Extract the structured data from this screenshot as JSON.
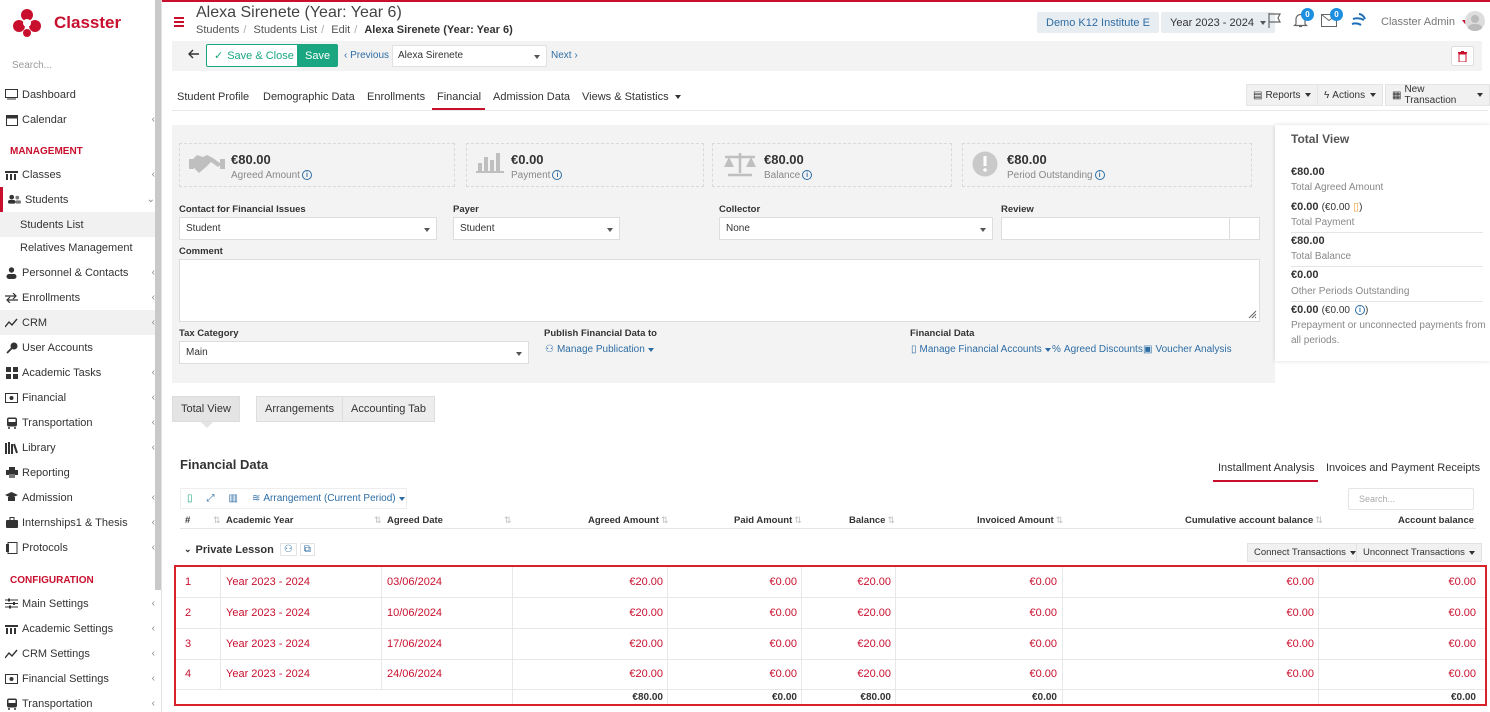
{
  "app": {
    "brand": "Classter",
    "search_placeholder": "Search..."
  },
  "sidebar": {
    "items": [
      {
        "label": "Dashboard",
        "icon": "monitor-icon"
      },
      {
        "label": "Calendar",
        "icon": "calendar-icon"
      },
      {
        "label": "Classes",
        "icon": "classes-icon"
      },
      {
        "label": "Students",
        "icon": "students-icon"
      },
      {
        "label": "Students List"
      },
      {
        "label": "Relatives Management"
      },
      {
        "label": "Personnel & Contacts",
        "icon": "person-icon"
      },
      {
        "label": "Enrollments",
        "icon": "arrows-icon"
      },
      {
        "label": "CRM",
        "icon": "crm-icon"
      },
      {
        "label": "User Accounts",
        "icon": "key-icon"
      },
      {
        "label": "Academic Tasks",
        "icon": "grid-icon"
      },
      {
        "label": "Financial",
        "icon": "money-icon"
      },
      {
        "label": "Transportation",
        "icon": "bus-icon"
      },
      {
        "label": "Library",
        "icon": "books-icon"
      },
      {
        "label": "Reporting",
        "icon": "printer-icon"
      },
      {
        "label": "Admission",
        "icon": "admission-icon"
      },
      {
        "label": "Internships1 & Thesis",
        "icon": "briefcase-icon"
      },
      {
        "label": "Protocols",
        "icon": "protocol-icon"
      },
      {
        "label": "Main Settings",
        "icon": "sliders-icon"
      },
      {
        "label": "Academic Settings",
        "icon": "classes-icon"
      },
      {
        "label": "CRM Settings",
        "icon": "crm-icon"
      },
      {
        "label": "Financial Settings",
        "icon": "money-icon"
      },
      {
        "label": "Transportation",
        "icon": "bus-icon"
      }
    ],
    "section_management": "MANAGEMENT",
    "section_configuration": "CONFIGURATION"
  },
  "header": {
    "title": "Alexa Sirenete (Year: Year 6)",
    "breadcrumb": [
      "Students",
      "Students List",
      "Edit",
      "Alexa Sirenete (Year: Year 6)"
    ],
    "institute": "Demo K12 Institute E",
    "year": "Year 2023 - 2024",
    "notifications_count": "0",
    "messages_count": "0",
    "user": "Classter Admin"
  },
  "toolbar": {
    "save_close": "Save & Close",
    "save": "Save",
    "previous": "Previous",
    "next": "Next",
    "student": "Alexa Sirenete"
  },
  "tabs": [
    "Student Profile",
    "Demographic Data",
    "Enrollments",
    "Financial",
    "Admission Data",
    "Views & Statistics"
  ],
  "actions": {
    "reports": "Reports",
    "actions": "Actions",
    "new_transaction": "New Transaction"
  },
  "kpis": [
    {
      "value": "€80.00",
      "label": "Agreed Amount"
    },
    {
      "value": "€0.00",
      "label": "Payment"
    },
    {
      "value": "€80.00",
      "label": "Balance"
    },
    {
      "value": "€80.00",
      "label": "Period Outstanding"
    }
  ],
  "form": {
    "contact_label": "Contact for Financial Issues",
    "contact_value": "Student",
    "payer_label": "Payer",
    "payer_value": "Student",
    "collector_label": "Collector",
    "collector_value": "None",
    "review_label": "Review",
    "comment_label": "Comment",
    "tax_label": "Tax Category",
    "tax_value": "Main",
    "publish_label": "Publish Financial Data to",
    "manage_publication": "Manage Publication",
    "fin_data_label": "Financial Data",
    "manage_accounts": "Manage Financial Accounts",
    "agreed_discounts": "Agreed Discounts",
    "voucher_analysis": "Voucher Analysis"
  },
  "total_view": {
    "title": "Total View",
    "rows": [
      {
        "value": "€80.00",
        "sub": "",
        "label": "Total Agreed Amount"
      },
      {
        "value": "€0.00",
        "sub": "(€0.00",
        "label": "Total Payment"
      },
      {
        "value": "€80.00",
        "sub": "",
        "label": "Total Balance"
      },
      {
        "value": "€0.00",
        "sub": "",
        "label": "Other Periods Outstanding"
      },
      {
        "value": "€0.00",
        "sub": "(€0.00",
        "label": "Prepayment or unconnected payments from all periods."
      }
    ],
    "close_paren": ")"
  },
  "subtabs": [
    "Total View",
    "Arrangements",
    "Accounting Tab"
  ],
  "financial": {
    "title": "Financial Data",
    "tab_installment": "Installment Analysis",
    "tab_invoices": "Invoices and Payment Receipts",
    "search_placeholder": "Search...",
    "arrangement": "Arrangement (Current Period)",
    "columns": [
      "#",
      "Academic Year",
      "Agreed Date",
      "Agreed Amount",
      "Paid Amount",
      "Balance",
      "Invoiced Amount",
      "Cumulative account balance",
      "Account balance"
    ],
    "group": "Private Lesson",
    "connect": "Connect Transactions",
    "unconnect": "Unconnect Transactions",
    "rows": [
      [
        "1",
        "Year 2023 - 2024",
        "03/06/2024",
        "€20.00",
        "€0.00",
        "€20.00",
        "€0.00",
        "€0.00",
        "€0.00"
      ],
      [
        "2",
        "Year 2023 - 2024",
        "10/06/2024",
        "€20.00",
        "€0.00",
        "€20.00",
        "€0.00",
        "€0.00",
        "€0.00"
      ],
      [
        "3",
        "Year 2023 - 2024",
        "17/06/2024",
        "€20.00",
        "€0.00",
        "€20.00",
        "€0.00",
        "€0.00",
        "€0.00"
      ],
      [
        "4",
        "Year 2023 - 2024",
        "24/06/2024",
        "€20.00",
        "€0.00",
        "€20.00",
        "€0.00",
        "€0.00",
        "€0.00"
      ]
    ],
    "totals": [
      "€80.00",
      "€0.00",
      "€80.00",
      "€0.00",
      "€0.00"
    ]
  },
  "colors": {
    "brand": "#c8102e",
    "accent": "#1aa680",
    "link": "#2e6da4"
  }
}
